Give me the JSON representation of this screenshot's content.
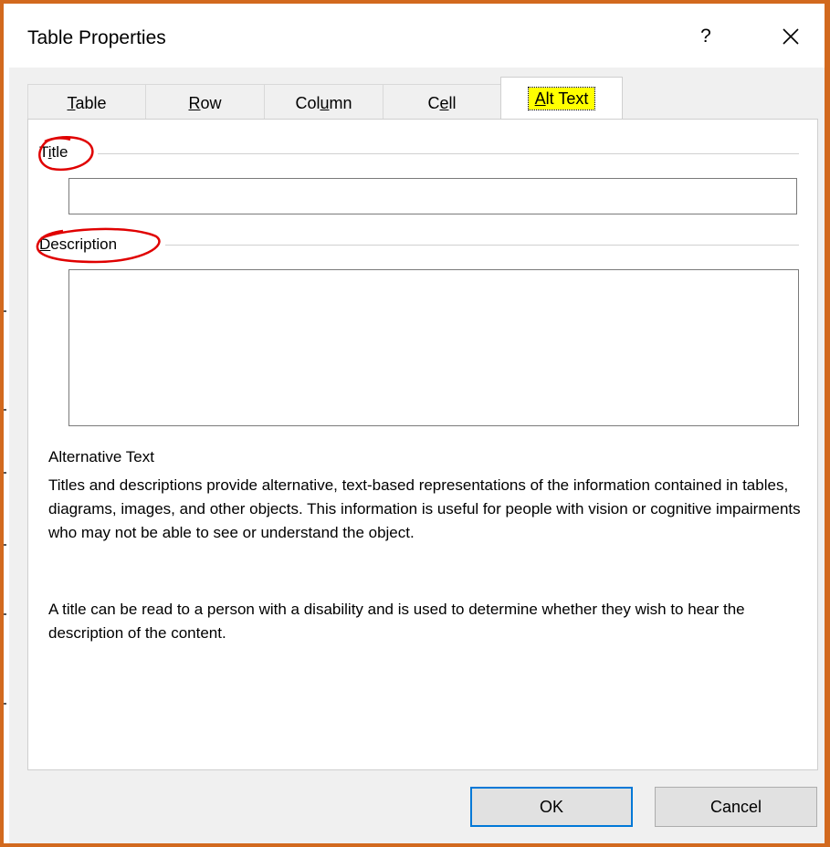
{
  "dialog": {
    "title": "Table Properties",
    "help_label": "?",
    "close_label": "✕"
  },
  "tabs": [
    {
      "pre": "",
      "key": "T",
      "post": "able"
    },
    {
      "pre": "",
      "key": "R",
      "post": "ow"
    },
    {
      "pre": "Col",
      "key": "u",
      "post": "mn"
    },
    {
      "pre": "C",
      "key": "e",
      "post": "ll"
    },
    {
      "pre": "",
      "key": "A",
      "post": "lt Text"
    }
  ],
  "fields": {
    "title": {
      "pre": "T",
      "key": "i",
      "post": "tle",
      "value": ""
    },
    "description": {
      "pre": "",
      "key": "D",
      "post": "escription",
      "value": ""
    }
  },
  "info": {
    "heading": "Alternative Text",
    "paragraph1": "Titles and descriptions provide alternative, text-based representations of the information contained in tables, diagrams, images, and other objects. This information is useful for people with vision or cognitive impairments who may not be able to see or understand the object.",
    "paragraph2": "A title can be read to a person with a disability and is used to determine whether they wish to hear the description of the content."
  },
  "buttons": {
    "ok": "OK",
    "cancel": "Cancel"
  },
  "colors": {
    "frame": "#d2691e",
    "highlight": "#ffff00",
    "annotation": "#e00000",
    "focus": "#0078d7"
  }
}
